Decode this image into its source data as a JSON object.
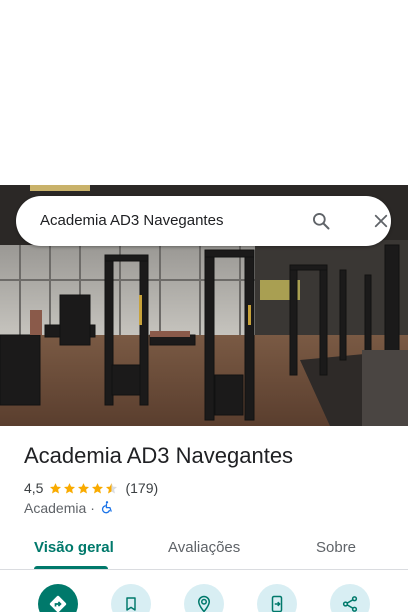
{
  "search": {
    "query": "Academia AD3 Navegantes"
  },
  "place": {
    "name": "Academia AD3 Navegantes",
    "rating": "4,5",
    "rating_stars": 4.5,
    "review_count": "(179)",
    "category": "Academia",
    "separator": "·"
  },
  "tabs": [
    {
      "label": "Visão geral",
      "active": true
    },
    {
      "label": "Avaliações",
      "active": false
    },
    {
      "label": "Sobre",
      "active": false
    }
  ],
  "actions": [
    {
      "icon": "directions-icon"
    },
    {
      "icon": "bookmark-icon"
    },
    {
      "icon": "nearby-icon"
    },
    {
      "icon": "send-to-phone-icon"
    },
    {
      "icon": "share-icon"
    }
  ],
  "colors": {
    "accent": "#00796b",
    "action_bg": "#d8eef3",
    "star": "#f9ab00",
    "accessibility": "#1a73e8"
  }
}
